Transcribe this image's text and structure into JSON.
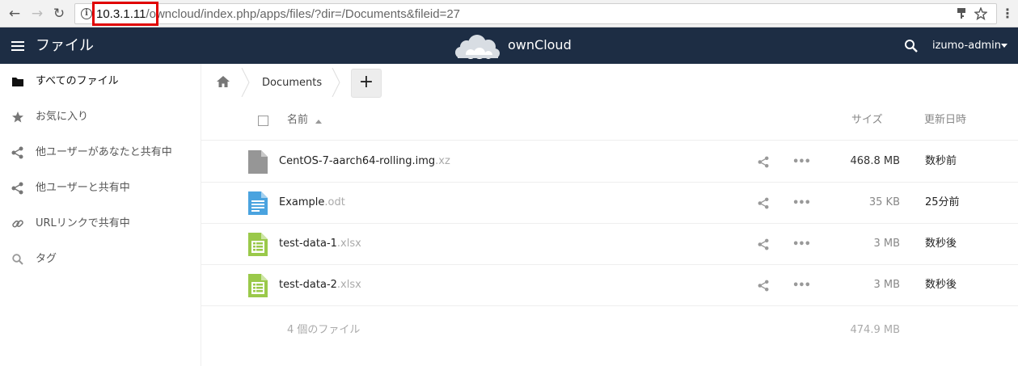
{
  "browser": {
    "url_host": "10.3.1.11",
    "url_rest": "/owncloud/index.php/apps/files/?dir=/Documents&fileid=27"
  },
  "header": {
    "app_title": "ファイル",
    "logo_text": "ownCloud",
    "user_name": "izumo-admin",
    "colors": {
      "header_bg": "#1d2d44",
      "accent": "#4aa3df"
    }
  },
  "sidebar": {
    "items": [
      {
        "label": "すべてのファイル",
        "icon": "folder-icon",
        "active": true
      },
      {
        "label": "お気に入り",
        "icon": "star-icon",
        "active": false
      },
      {
        "label": "他ユーザーがあなたと共有中",
        "icon": "share-icon",
        "active": false
      },
      {
        "label": "他ユーザーと共有中",
        "icon": "share-icon",
        "active": false
      },
      {
        "label": "URLリンクで共有中",
        "icon": "link-icon",
        "active": false
      },
      {
        "label": "タグ",
        "icon": "tag-search-icon",
        "active": false
      }
    ]
  },
  "breadcrumb": {
    "home_icon": "home-icon",
    "items": [
      "Documents"
    ],
    "new_button": "+"
  },
  "file_list": {
    "columns": {
      "name": "名前",
      "size": "サイズ",
      "modified": "更新日時"
    },
    "rows": [
      {
        "base": "CentOS-7-aarch64-rolling.img",
        "ext": ".xz",
        "icon": "file-generic-icon",
        "size": "468.8 MB",
        "modified": "数秒前"
      },
      {
        "base": "Example",
        "ext": ".odt",
        "icon": "file-text-icon",
        "size": "35 KB",
        "modified": "25分前"
      },
      {
        "base": "test-data-1",
        "ext": ".xlsx",
        "icon": "file-spreadsheet-icon",
        "size": "3 MB",
        "modified": "数秒後"
      },
      {
        "base": "test-data-2",
        "ext": ".xlsx",
        "icon": "file-spreadsheet-icon",
        "size": "3 MB",
        "modified": "数秒後"
      }
    ],
    "summary": {
      "count": "4 個のファイル",
      "total_size": "474.9 MB"
    }
  }
}
